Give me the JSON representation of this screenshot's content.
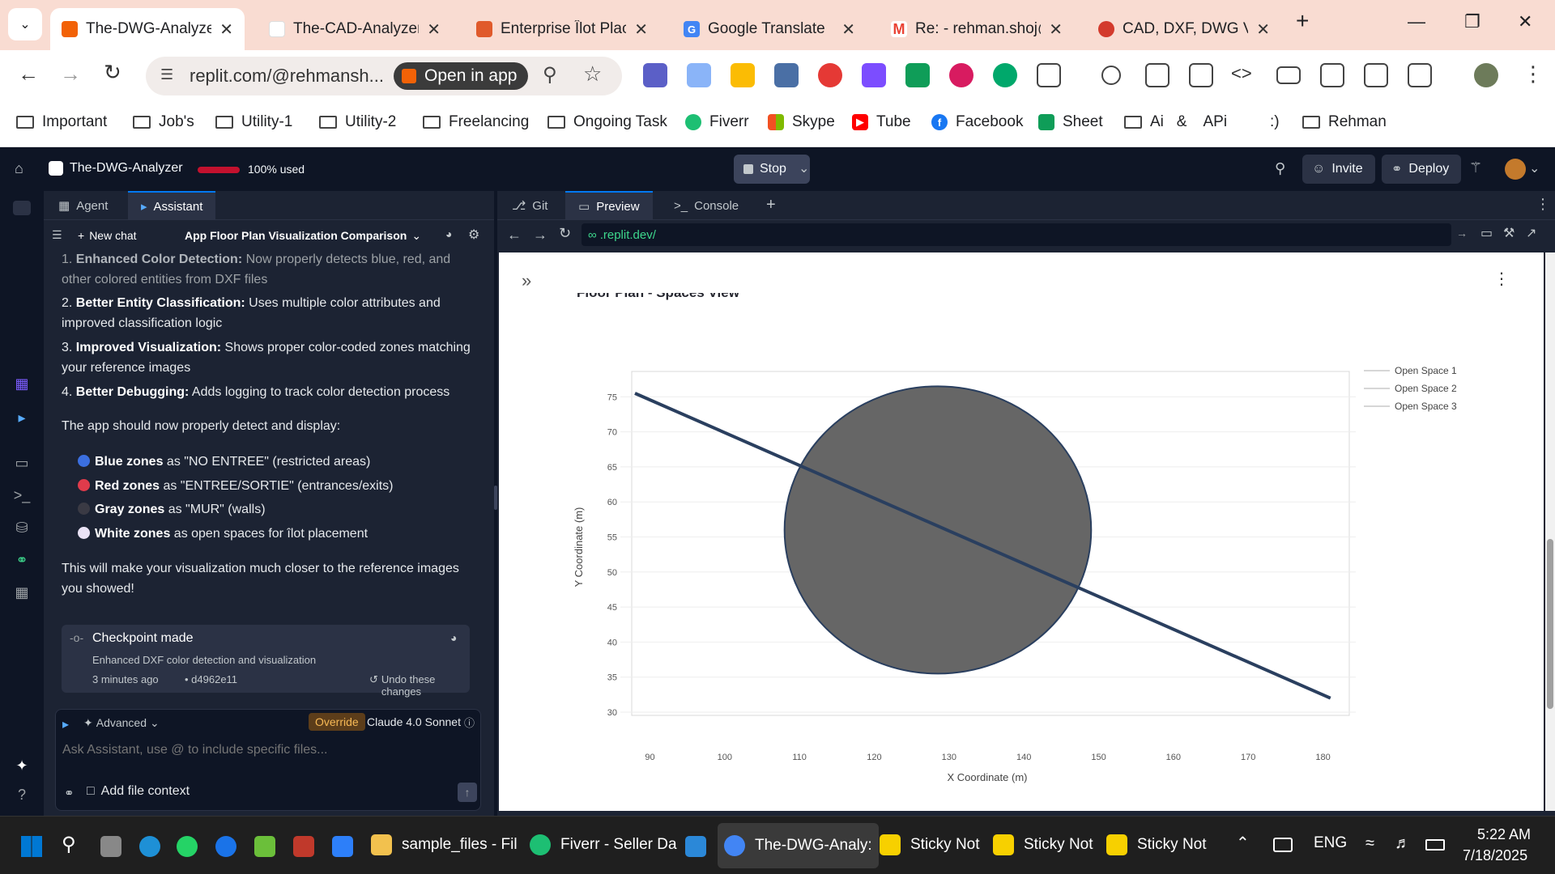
{
  "browser": {
    "tabs": [
      {
        "title": "The-DWG-Analyzer",
        "active": true,
        "favicon_color": "#f26207"
      },
      {
        "title": "The-CAD-Analyzer",
        "active": false,
        "favicon_color": "#ffffff"
      },
      {
        "title": "Enterprise Îlot Plac",
        "active": false,
        "favicon_color": "#e05a2b"
      },
      {
        "title": "Google Translate",
        "active": false,
        "favicon_color": "#4285f4"
      },
      {
        "title": "Re: - rehman.shoj@",
        "active": false,
        "favicon_color": "#ea4335"
      },
      {
        "title": "CAD, DXF, DWG Vi",
        "active": false,
        "favicon_color": "#d33a2c"
      }
    ],
    "new_tab": "+",
    "url": "replit.com/@rehmansh...",
    "open_in_app": "Open in app",
    "bookmarks": [
      {
        "label": "Important",
        "icon": "folder-icon"
      },
      {
        "label": "Job's",
        "icon": "folder-icon"
      },
      {
        "label": "Utility-1",
        "icon": "folder-icon"
      },
      {
        "label": "Utility-2",
        "icon": "folder-icon"
      },
      {
        "label": "Freelancing",
        "icon": "folder-icon"
      },
      {
        "label": "Ongoing Task",
        "icon": "folder-icon"
      },
      {
        "label": "Fiverr",
        "icon": "fiverr-icon"
      },
      {
        "label": "Skype",
        "icon": "skype-icon"
      },
      {
        "label": "Tube",
        "icon": "youtube-icon"
      },
      {
        "label": "Facebook",
        "icon": "facebook-icon"
      },
      {
        "label": "Sheet",
        "icon": "sheets-icon"
      },
      {
        "label": "Ai   &    APi",
        "icon": "folder-icon"
      },
      {
        "label": ":)",
        "icon": ""
      },
      {
        "label": "Rehman",
        "icon": "folder-icon"
      }
    ]
  },
  "replit": {
    "project": "The-DWG-Analyzer",
    "usage": "100% used",
    "stop": "Stop",
    "invite": "Invite",
    "deploy": "Deploy"
  },
  "assistant": {
    "tabs": [
      "Agent",
      "Assistant"
    ],
    "new_chat": "New chat",
    "chat_title": "App Floor Plan Visualization Comparison",
    "items": [
      {
        "num": "1.",
        "bold": "Enhanced Color Detection:",
        "text": " Now properly detects blue, red, and other colored entities from DXF files"
      },
      {
        "num": "2.",
        "bold": "Better Entity Classification:",
        "text": " Uses multiple color attributes and improved classification logic"
      },
      {
        "num": "3.",
        "bold": "Improved Visualization:",
        "text": " Shows proper color-coded zones matching your reference images"
      },
      {
        "num": "4.",
        "bold": "Better Debugging:",
        "text": " Adds logging to track color detection process"
      }
    ],
    "intro": "The app should now properly detect and display:",
    "bullets": [
      {
        "bold": "Blue zones",
        "text": " as \"NO ENTREE\" (restricted areas)",
        "color": "#3b6fe0"
      },
      {
        "bold": "Red zones",
        "text": " as \"ENTREE/SORTIE\" (entrances/exits)",
        "color": "#e03b4b"
      },
      {
        "bold": "Gray zones",
        "text": " as \"MUR\" (walls)",
        "color": "#3a3a44"
      },
      {
        "bold": "White zones",
        "text": " as open spaces for îlot placement",
        "color": "#e9e2f5"
      }
    ],
    "closing": "This will make your visualization much closer to the reference images you showed!",
    "checkpoint": {
      "title": "Checkpoint made",
      "desc": "Enhanced DXF color detection and visualization",
      "time": "3 minutes ago",
      "hash": "• d4962e11",
      "undo": "Undo these changes"
    },
    "advanced": "Advanced",
    "override": "Override",
    "model": "Claude 4.0 Sonnet",
    "placeholder": "Ask Assistant, use @ to include specific files...",
    "add_context": "Add file context"
  },
  "preview": {
    "tabs": [
      "Git",
      "Preview",
      "Console"
    ],
    "url": ".replit.dev/",
    "partial_title": "Floor Plan - Spaces View"
  },
  "chart_data": {
    "type": "scatter",
    "title": "",
    "xlabel": "X Coordinate (m)",
    "ylabel": "Y Coordinate (m)",
    "xlim": [
      88,
      182
    ],
    "ylim": [
      30,
      77
    ],
    "x_ticks": [
      90,
      100,
      110,
      120,
      130,
      140,
      150,
      160,
      170,
      180
    ],
    "y_ticks": [
      30,
      35,
      40,
      45,
      50,
      55,
      60,
      65,
      70,
      75
    ],
    "legend_position": "top-right",
    "legend": [
      "Open Space 1",
      "Open Space 2",
      "Open Space 3"
    ],
    "series": [
      {
        "name": "Open Space 1",
        "kind": "line",
        "x": [
          88,
          181
        ],
        "y": [
          75.5,
          32
        ],
        "color": "#2a3f5f"
      },
      {
        "name": "Open Space 2",
        "kind": "circle",
        "center": [
          128.5,
          56
        ],
        "radius_x": 20.5,
        "radius_y": 20.5,
        "fill": "#666666",
        "stroke": "#2a3f5f"
      }
    ],
    "grid": true
  },
  "taskbar": {
    "items": [
      {
        "label": "sample_files - Fil",
        "color": "#f2c14e"
      },
      {
        "label": "Fiverr - Seller Da",
        "color": "#1dbf73"
      },
      {
        "label": "The-DWG-Analy:",
        "color": "#4285f4"
      },
      {
        "label": "Sticky Not",
        "color": "#f7d000"
      },
      {
        "label": "Sticky Not",
        "color": "#f7d000"
      },
      {
        "label": "Sticky Not",
        "color": "#f7d000"
      }
    ],
    "lang": "ENG",
    "time": "5:22 AM",
    "date": "7/18/2025"
  }
}
